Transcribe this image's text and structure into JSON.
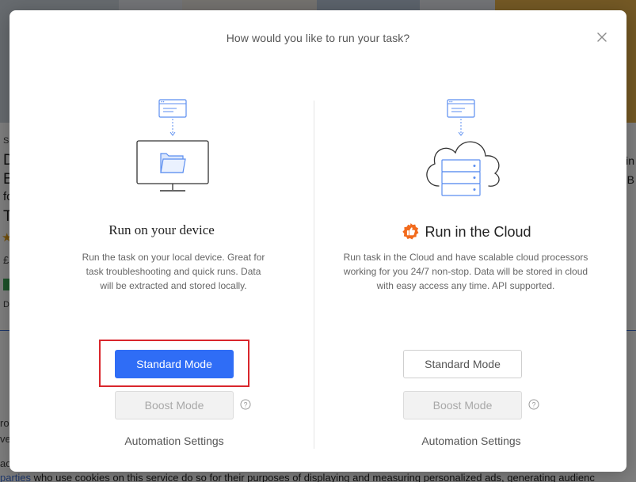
{
  "background": {
    "left_letters": [
      "D",
      "B",
      "fo",
      "T"
    ],
    "left_small": "Sp",
    "left_price": "£",
    "left_d": "D",
    "right_letters": [
      "in",
      "B"
    ],
    "left_lower_letters": [
      "ro",
      "ve",
      "ac"
    ],
    "bottom_text_link": "parties",
    "bottom_text_rest": " who use cookies on this service do so for their purposes of displaying and measuring personalized ads, generating audienc"
  },
  "modal": {
    "title": "How would you like to run your task?",
    "close_icon": "close-icon",
    "local": {
      "title": "Run on your device",
      "description": "Run the task on your local device. Great for task troubleshooting and quick runs. Data will be extracted and stored locally.",
      "primary_label": "Standard Mode",
      "secondary_label": "Boost Mode",
      "settings_label": "Automation Settings"
    },
    "cloud": {
      "title": "Run in the Cloud",
      "description": "Run task in the Cloud and have scalable cloud processors working for you 24/7 non-stop. Data will be stored in cloud with easy access any time. API supported.",
      "primary_label": "Standard Mode",
      "secondary_label": "Boost Mode",
      "settings_label": "Automation Settings"
    }
  },
  "colors": {
    "primary": "#2f6df6",
    "highlight": "#d9262c",
    "badge": "#f26b1d",
    "illustration_blue": "#5b8ef0"
  }
}
